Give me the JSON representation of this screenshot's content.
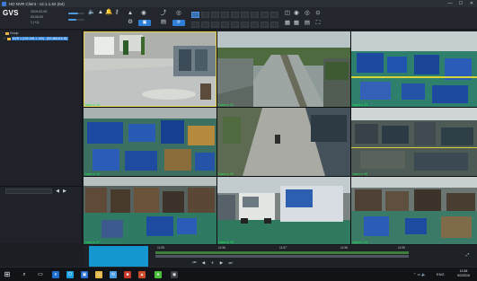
{
  "window": {
    "title": "HD NVR Client - v2.1.1.62 (64)",
    "minimize": "—",
    "maximize": "☐",
    "close": "✕"
  },
  "toolbar": {
    "logo": "GVS",
    "info_lines": [
      "2019-02-09",
      "00:00:00",
      "1 (+1)"
    ],
    "volume_fraction": 0.6,
    "icons": [
      "bell-icon",
      "settings-icon",
      "record-icon",
      "camera-icon",
      "fullscreen-icon",
      "export-icon",
      "sync-icon"
    ],
    "mode_buttons": [
      "▣",
      "▤",
      "⟳"
    ]
  },
  "sidebar": {
    "tree": [
      {
        "label": "Group",
        "level": 0
      },
      {
        "label": "NVR 1 (192.168.1.100) - [DS-8664NI-I8]",
        "level": 1,
        "selected": true
      }
    ],
    "search_placeholder": "",
    "prev_arrow": "◀",
    "next_arrow": "▶"
  },
  "cameras": [
    {
      "label": "Camera 01",
      "theme": "office"
    },
    {
      "label": "Camera 02",
      "theme": "yard"
    },
    {
      "label": "Camera 03",
      "theme": "warehouse"
    },
    {
      "label": "Camera 04",
      "theme": "storage"
    },
    {
      "label": "Camera 05",
      "theme": "corridor"
    },
    {
      "label": "Camera 06",
      "theme": "workshop"
    },
    {
      "label": "Camera 07",
      "theme": "racks"
    },
    {
      "label": "Camera 08",
      "theme": "loading"
    },
    {
      "label": "Camera 09",
      "theme": "floor"
    }
  ],
  "timeline": {
    "ticks": [
      "11:55",
      "11:56",
      "11:57",
      "11:58",
      "11:59"
    ],
    "controls": [
      "⏮",
      "◀",
      "⏸",
      "▶",
      "⏭",
      "⤢"
    ]
  },
  "taskbar": {
    "start": "⊞",
    "apps": [
      "search-icon",
      "task-view-icon",
      "edge-icon",
      "explorer-icon",
      "store-icon",
      "mail-icon",
      "app-icon",
      "nvr-client-icon"
    ],
    "tray_lang": "ENG",
    "time": "11:58",
    "date": "9/2/2019"
  }
}
